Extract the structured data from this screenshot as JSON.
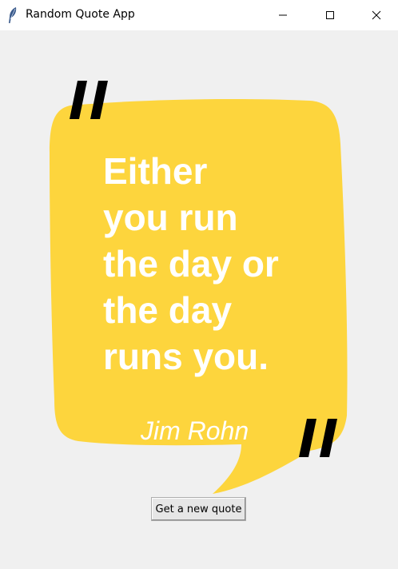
{
  "window": {
    "title": "Random Quote App",
    "icon": "feather-icon",
    "controls": [
      "minimize-icon",
      "maximize-icon",
      "close-icon"
    ]
  },
  "quote": {
    "text": "Either\nyou run\nthe day or\nthe day\nruns you.",
    "author": "Jim Rohn",
    "open_mark": "\"",
    "close_mark": "\""
  },
  "actions": {
    "new_quote_label": "Get a new quote"
  },
  "colors": {
    "bubble": "#fdd53d",
    "quote_text": "#ffffff",
    "quote_marks": "#000000",
    "background": "#f0f0f0"
  }
}
